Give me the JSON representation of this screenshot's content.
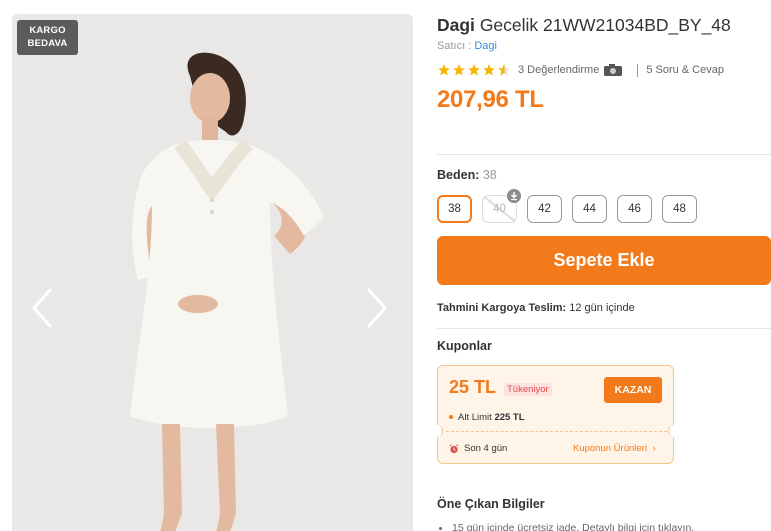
{
  "gallery": {
    "badge_line1": "KARGO",
    "badge_line2": "BEDAVA",
    "prev_icon": "chevron-left-icon",
    "next_icon": "chevron-right-icon"
  },
  "product": {
    "brand": "Dagi",
    "name": "Gecelik 21WW21034BD_BY_48",
    "seller_label": "Satıcı :",
    "seller_name": "Dagi",
    "rating_stars": 4.5,
    "reviews_label": "3 Değerlendirme",
    "questions_label": "5 Soru & Cevap",
    "price": "207,96 TL"
  },
  "size": {
    "label": "Beden:",
    "selected": "38",
    "options": [
      "38",
      "40",
      "42",
      "44",
      "46",
      "48"
    ]
  },
  "actions": {
    "add_to_cart": "Sepete Ekle"
  },
  "delivery": {
    "label": "Tahmini Kargoya Teslim:",
    "value": "12 gün içinde"
  },
  "coupons": {
    "title": "Kuponlar",
    "amount": "25 TL",
    "status": "Tükeniyor",
    "button": "KAZAN",
    "limit_label": "Alt Limit",
    "limit_value": "225 TL",
    "expire": "Son 4 gün",
    "link": "Kuponun Ürünleri"
  },
  "features": {
    "title": "Öne Çıkan Bilgiler",
    "first_item": "15 gün içinde ücretsiz iade. Detaylı bilgi için tıklayın."
  },
  "colors": {
    "accent": "#f27a1a",
    "star": "#f7b500",
    "link": "#3a8bd7"
  }
}
